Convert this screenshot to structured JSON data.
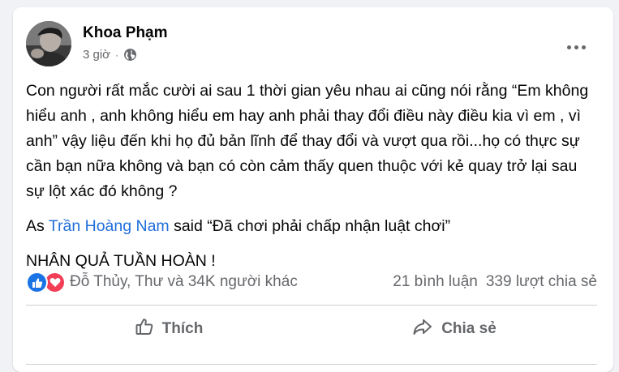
{
  "post": {
    "author": "Khoa Phạm",
    "time": "3 giờ",
    "separator": "·",
    "privacy_icon": "globe-icon",
    "paragraph1": "Con người rất mắc cười ai sau 1 thời gian yêu nhau ai cũng nói rằng “Em không hiểu anh , anh không hiểu em hay anh phải thay đổi điều này điều kia vì em , vì anh” vậy liệu đến khi họ đủ bản lĩnh để thay đổi và vượt qua rồi...họ có thực sự cần bạn nữa không và bạn có còn cảm thấy quen thuộc với kẻ quay trở lại sau sự lột xác đó không ?",
    "para2_prefix": "As ",
    "para2_mention": "Trần Hoàng Nam",
    "para2_suffix": " said “Đã chơi phải chấp nhận luật chơi”",
    "paragraph3": "NHÂN QUẢ TUẦN HOÀN !"
  },
  "reactions": {
    "icons": [
      "like-reaction-icon",
      "love-reaction-icon"
    ],
    "reactors": "Đỗ Thủy, Thư và 34K người khác",
    "comments": "21 bình luận",
    "shares": "339 lượt chia sẻ"
  },
  "actions": {
    "like": "Thích",
    "share": "Chia sẻ"
  },
  "colors": {
    "background": "#f0f2f5",
    "mention": "#216fdb",
    "like_blue": "#1b74e4",
    "love_red": "#f33e58",
    "secondary_text": "#65676b"
  }
}
